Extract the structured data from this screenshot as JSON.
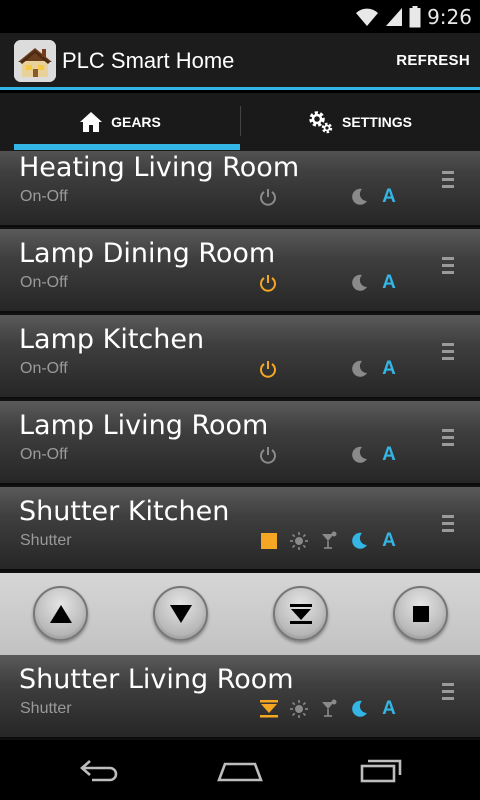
{
  "status": {
    "time": "9:26"
  },
  "app": {
    "title": "PLC Smart Home",
    "refresh_label": "REFRESH"
  },
  "tabs": [
    {
      "label": "GEARS",
      "selected": true
    },
    {
      "label": "SETTINGS",
      "selected": false
    }
  ],
  "gears": [
    {
      "title": "Heating Living Room",
      "type": "On-Off",
      "power": "off",
      "auto": "A"
    },
    {
      "title": "Lamp Dining Room",
      "type": "On-Off",
      "power": "on",
      "auto": "A"
    },
    {
      "title": "Lamp Kitchen",
      "type": "On-Off",
      "power": "on",
      "auto": "A"
    },
    {
      "title": "Lamp Living Room",
      "type": "On-Off",
      "power": "off",
      "auto": "A"
    },
    {
      "title": "Shutter Kitchen",
      "type": "Shutter",
      "state": "stop",
      "auto": "A"
    },
    {
      "title": "Shutter Living Room",
      "type": "Shutter",
      "state": "lowered",
      "auto": "A"
    }
  ],
  "shutter_controls": [
    "up",
    "down",
    "lower-to-position",
    "stop"
  ],
  "colors": {
    "accent": "#33b5e5",
    "active": "#f5a623",
    "inactive": "#8a8a8a"
  }
}
